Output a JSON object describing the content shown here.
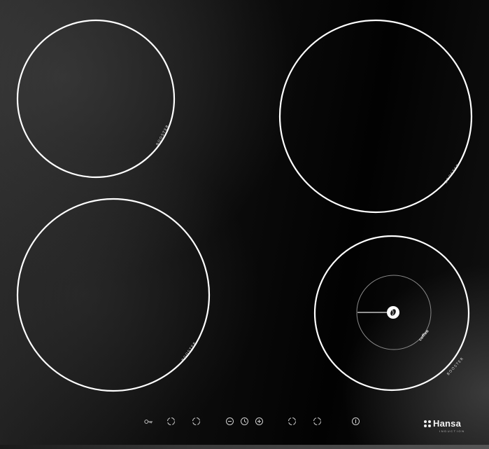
{
  "zones": [
    {
      "name": "rear-left",
      "label": "BOOSTER"
    },
    {
      "name": "rear-right",
      "label": "BOOSTER"
    },
    {
      "name": "front-left",
      "label": "BOOSTER"
    },
    {
      "name": "front-right",
      "label": "BOOSTER",
      "inner_label": "coffee"
    }
  ],
  "controls": [
    {
      "name": "lock-key-icon"
    },
    {
      "name": "zone-select-1-icon"
    },
    {
      "name": "zone-select-2-icon"
    },
    {
      "name": "minus-icon"
    },
    {
      "name": "timer-clock-icon"
    },
    {
      "name": "plus-icon"
    },
    {
      "name": "zone-select-3-icon"
    },
    {
      "name": "zone-select-4-icon"
    },
    {
      "name": "power-icon"
    }
  ],
  "brand": {
    "name": "Hansa",
    "sub": "INDUCTION"
  },
  "colors": {
    "glass": "#050505",
    "ring": "#ffffff",
    "print": "#d8d8d8"
  }
}
